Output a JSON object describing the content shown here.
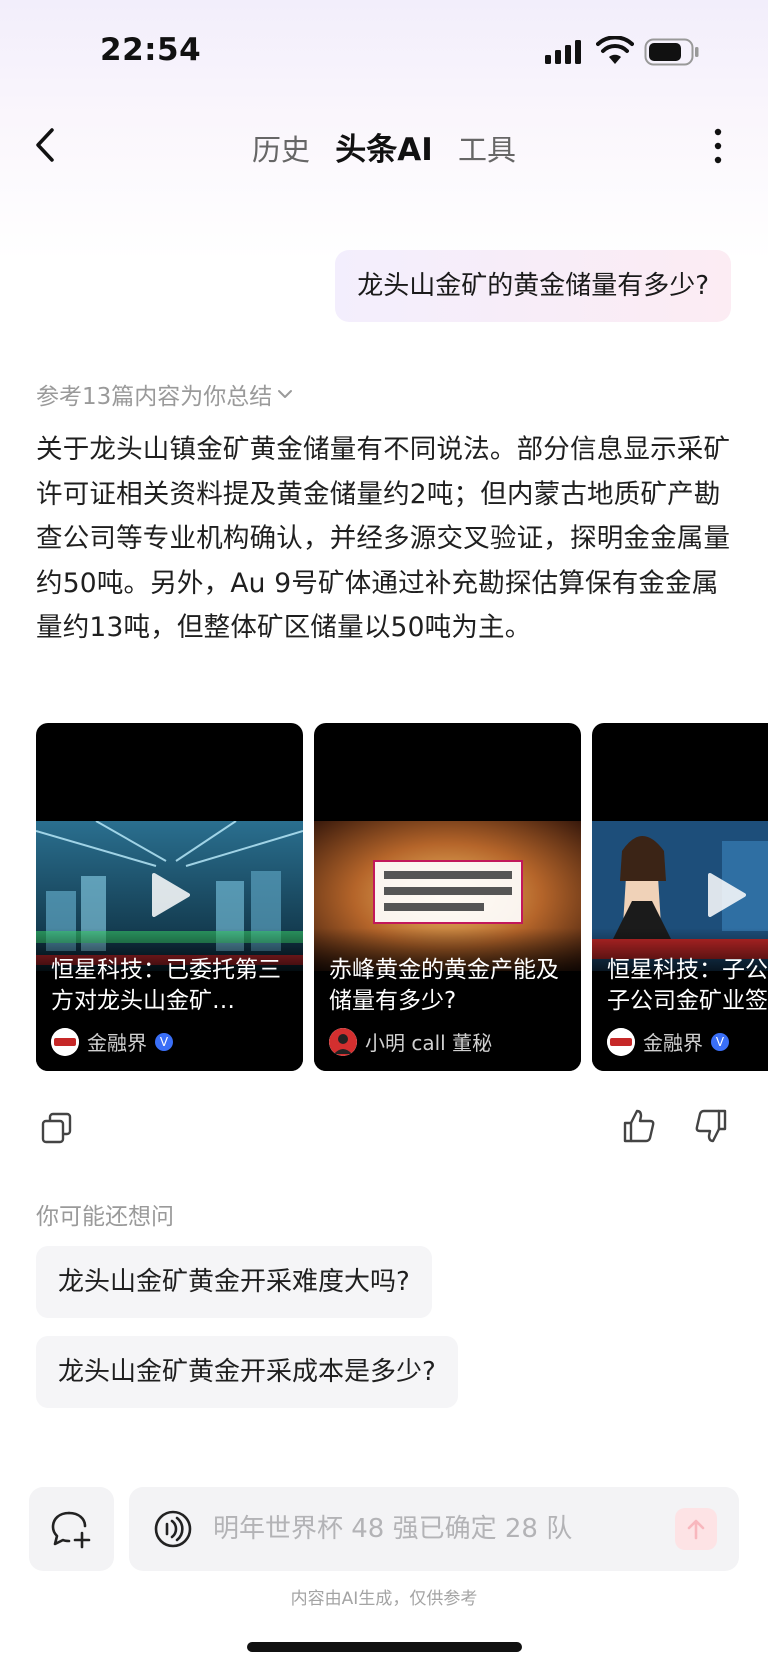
{
  "status_bar": {
    "time": "22:54"
  },
  "nav": {
    "tabs": [
      {
        "label": "历史",
        "active": false
      },
      {
        "label": "头条AI",
        "active": true
      },
      {
        "label": "工具",
        "active": false
      }
    ]
  },
  "user_message": "龙头山金矿的黄金储量有多少?",
  "answer": {
    "reference_summary": "参考13篇内容为你总结",
    "text": "关于龙头山镇金矿黄金储量有不同说法。部分信息显示采矿许可证相关资料提及黄金储量约2吨；但内蒙古地质矿产勘查公司等专业机构确认，并经多源交叉验证，探明金金属量约50吨。另外，Au 9号矿体通过补充勘探估算保有金金属量约13吨，但整体矿区储量以50吨为主。"
  },
  "video_cards": [
    {
      "title": "恒星科技：已委托第三方对龙头山金矿…",
      "author": "金融界",
      "verified": true,
      "avatar_text": "金融界"
    },
    {
      "title": "赤峰黄金的黄金产能及储量有多少?",
      "author": "小明 call 董秘",
      "verified": false,
      "avatar_text": ""
    },
    {
      "title": "恒星科技：子公司全资子公司金矿业签订龙头",
      "author": "金融界",
      "verified": true,
      "avatar_text": "金融界"
    }
  ],
  "suggestions": {
    "heading": "你可能还想问",
    "items": [
      "龙头山金矿黄金开采难度大吗?",
      "龙头山金矿黄金开采成本是多少?"
    ]
  },
  "input": {
    "placeholder": "明年世界杯 48 强已确定 28 队"
  },
  "disclaimer": "内容由AI生成，仅供参考",
  "colors": {
    "accent_pink": "#fde3e5",
    "verified_blue": "#3a6ff7",
    "muted_text": "#9a9a9a"
  }
}
